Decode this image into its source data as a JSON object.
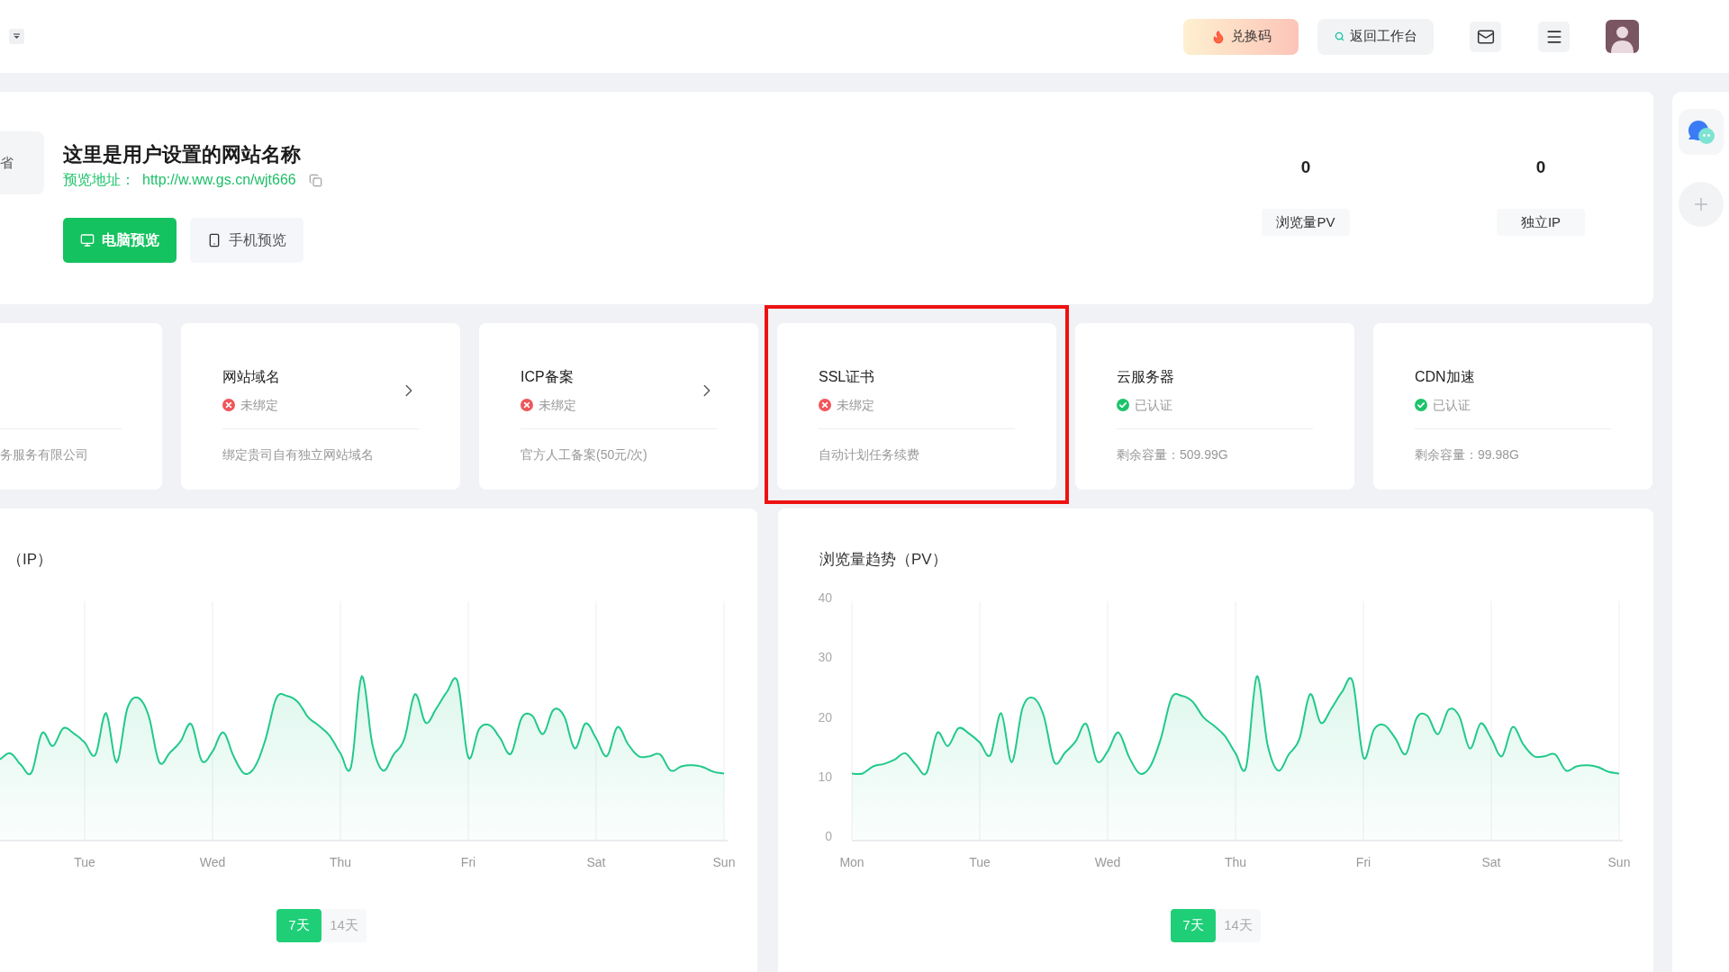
{
  "topbar": {
    "redeem_button": {
      "label": "兑换码"
    },
    "workbench_button": {
      "label": "返回工作台"
    }
  },
  "site": {
    "logo_text": "省",
    "name": "这里是用户设置的网站名称",
    "preview_label": "预览地址：",
    "preview_url": "http://w.ww.gs.cn/wjt666",
    "preview_buttons": [
      {
        "label": "电脑预览",
        "kind": "desktop"
      },
      {
        "label": "手机预览",
        "kind": "mobile"
      }
    ]
  },
  "stats": [
    {
      "value": "0",
      "label": "浏览量PV"
    },
    {
      "value": "0",
      "label": "独立IP"
    }
  ],
  "edge_card": {
    "description": "务服务有限公司"
  },
  "cards": [
    {
      "title": "网站域名",
      "status": "未绑定",
      "verified": false,
      "chevron": true,
      "description": "绑定贵司自有独立网站域名",
      "highlighted": false
    },
    {
      "title": "ICP备案",
      "status": "未绑定",
      "verified": false,
      "chevron": true,
      "description": "官方人工备案(50元/次)",
      "highlighted": false
    },
    {
      "title": "SSL证书",
      "status": "未绑定",
      "verified": false,
      "chevron": false,
      "description": "自动计划任务续费",
      "highlighted": true
    },
    {
      "title": "云服务器",
      "status": "已认证",
      "verified": true,
      "chevron": false,
      "description": "剩余容量：509.99G",
      "highlighted": false
    },
    {
      "title": "CDN加速",
      "status": "已认证",
      "verified": true,
      "chevron": false,
      "description": "剩余容量：99.98G",
      "highlighted": false
    }
  ],
  "ip_chart": {
    "title": "（IP）",
    "x_labels": [
      "Tue",
      "Wed",
      "Thu",
      "Fri",
      "Sat",
      "Sun"
    ],
    "ranges": [
      {
        "label": "7天",
        "selected": true
      },
      {
        "label": "14天",
        "selected": false
      }
    ]
  },
  "pv_chart": {
    "chart_data": {
      "type": "area",
      "title": "浏览量趋势（PV）",
      "categories": [
        "Mon",
        null,
        null,
        null,
        null,
        null,
        null,
        null,
        null,
        null,
        null,
        null,
        "Tue",
        null,
        null,
        null,
        null,
        null,
        null,
        null,
        null,
        null,
        null,
        null,
        "Wed",
        null,
        null,
        null,
        null,
        null,
        null,
        null,
        null,
        null,
        null,
        null,
        "Thu",
        null,
        null,
        null,
        null,
        null,
        null,
        null,
        null,
        null,
        null,
        null,
        "Fri",
        null,
        null,
        null,
        null,
        null,
        null,
        null,
        null,
        null,
        null,
        null,
        "Sat",
        null,
        null,
        null,
        null,
        null,
        null,
        null,
        null,
        null,
        null,
        null,
        "Sun"
      ],
      "values": [
        11.1,
        11.1,
        12.3,
        12.7,
        13.4,
        14.5,
        12.6,
        11.2,
        17.9,
        15.7,
        18.7,
        17.8,
        16.3,
        14.2,
        21.2,
        13.0,
        22.0,
        23.8,
        20.8,
        13.0,
        14.6,
        16.5,
        19.4,
        13.2,
        14.8,
        18.0,
        13.9,
        11.1,
        12.3,
        17.0,
        23.8,
        24.1,
        23.1,
        20.5,
        19.1,
        17.4,
        14.5,
        12.2,
        27.4,
        16.0,
        11.6,
        14.3,
        16.9,
        24.4,
        19.6,
        22.0,
        24.8,
        26.5,
        13.8,
        18.5,
        19.2,
        17.0,
        14.4,
        20.4,
        20.8,
        17.7,
        21.8,
        20.7,
        15.3,
        19.5,
        17.0,
        14.0,
        18.9,
        16.0,
        14.0,
        14.0,
        14.3,
        11.6,
        12.3,
        12.5,
        12.2,
        11.4,
        11.1
      ],
      "ylim": [
        0,
        40
      ],
      "yticks": [
        0,
        10,
        20,
        30,
        40
      ],
      "grid": true
    },
    "ranges": [
      {
        "label": "7天",
        "selected": true
      },
      {
        "label": "14天",
        "selected": false
      }
    ]
  }
}
